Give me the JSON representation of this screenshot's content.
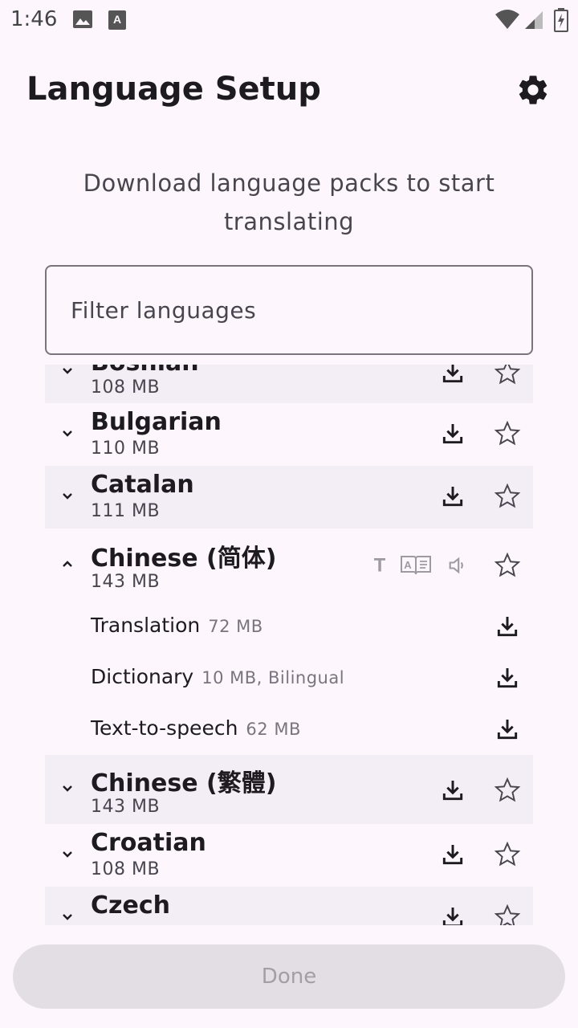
{
  "status_bar": {
    "time": "1:46",
    "icons": [
      "image-icon",
      "translate-a-icon",
      "wifi-icon",
      "signal-icon",
      "battery-charging-icon"
    ]
  },
  "header": {
    "title": "Language Setup",
    "settings_icon": "gear-icon"
  },
  "intro": {
    "text": "Download language packs to start translating"
  },
  "filter": {
    "placeholder": "Filter languages"
  },
  "languages": [
    {
      "name": "Bosnian",
      "size": "108 MB",
      "expanded": false
    },
    {
      "name": "Bulgarian",
      "size": "110 MB",
      "expanded": false
    },
    {
      "name": "Catalan",
      "size": "111 MB",
      "expanded": false
    },
    {
      "name": "Chinese (简体)",
      "size": "143 MB",
      "expanded": true,
      "packs": [
        {
          "label": "Translation",
          "meta": "72 MB"
        },
        {
          "label": "Dictionary",
          "meta": "10 MB, Bilingual"
        },
        {
          "label": "Text-to-speech",
          "meta": "62 MB"
        }
      ]
    },
    {
      "name": "Chinese (繁體)",
      "size": "143 MB",
      "expanded": false
    },
    {
      "name": "Croatian",
      "size": "108 MB",
      "expanded": false
    },
    {
      "name": "Czech",
      "size": "",
      "expanded": false
    }
  ],
  "footer": {
    "done_label": "Done"
  },
  "colors": {
    "background": "#fdf7fd",
    "row_shade": "#f3edf5",
    "icon_muted": "#9e9aa3",
    "button_disabled": "#e3dee4"
  }
}
